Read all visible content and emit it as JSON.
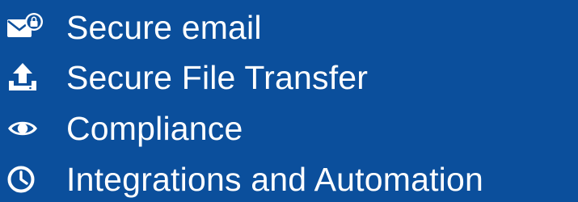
{
  "background_color": "#0b4f9c",
  "text_color": "#ffffff",
  "features": [
    {
      "label": "Secure email",
      "icon": "lock-envelope-icon"
    },
    {
      "label": "Secure File Transfer",
      "icon": "upload-tray-icon"
    },
    {
      "label": "Compliance",
      "icon": "eye-icon"
    },
    {
      "label": "Integrations and Automation",
      "icon": "clock-icon"
    }
  ]
}
